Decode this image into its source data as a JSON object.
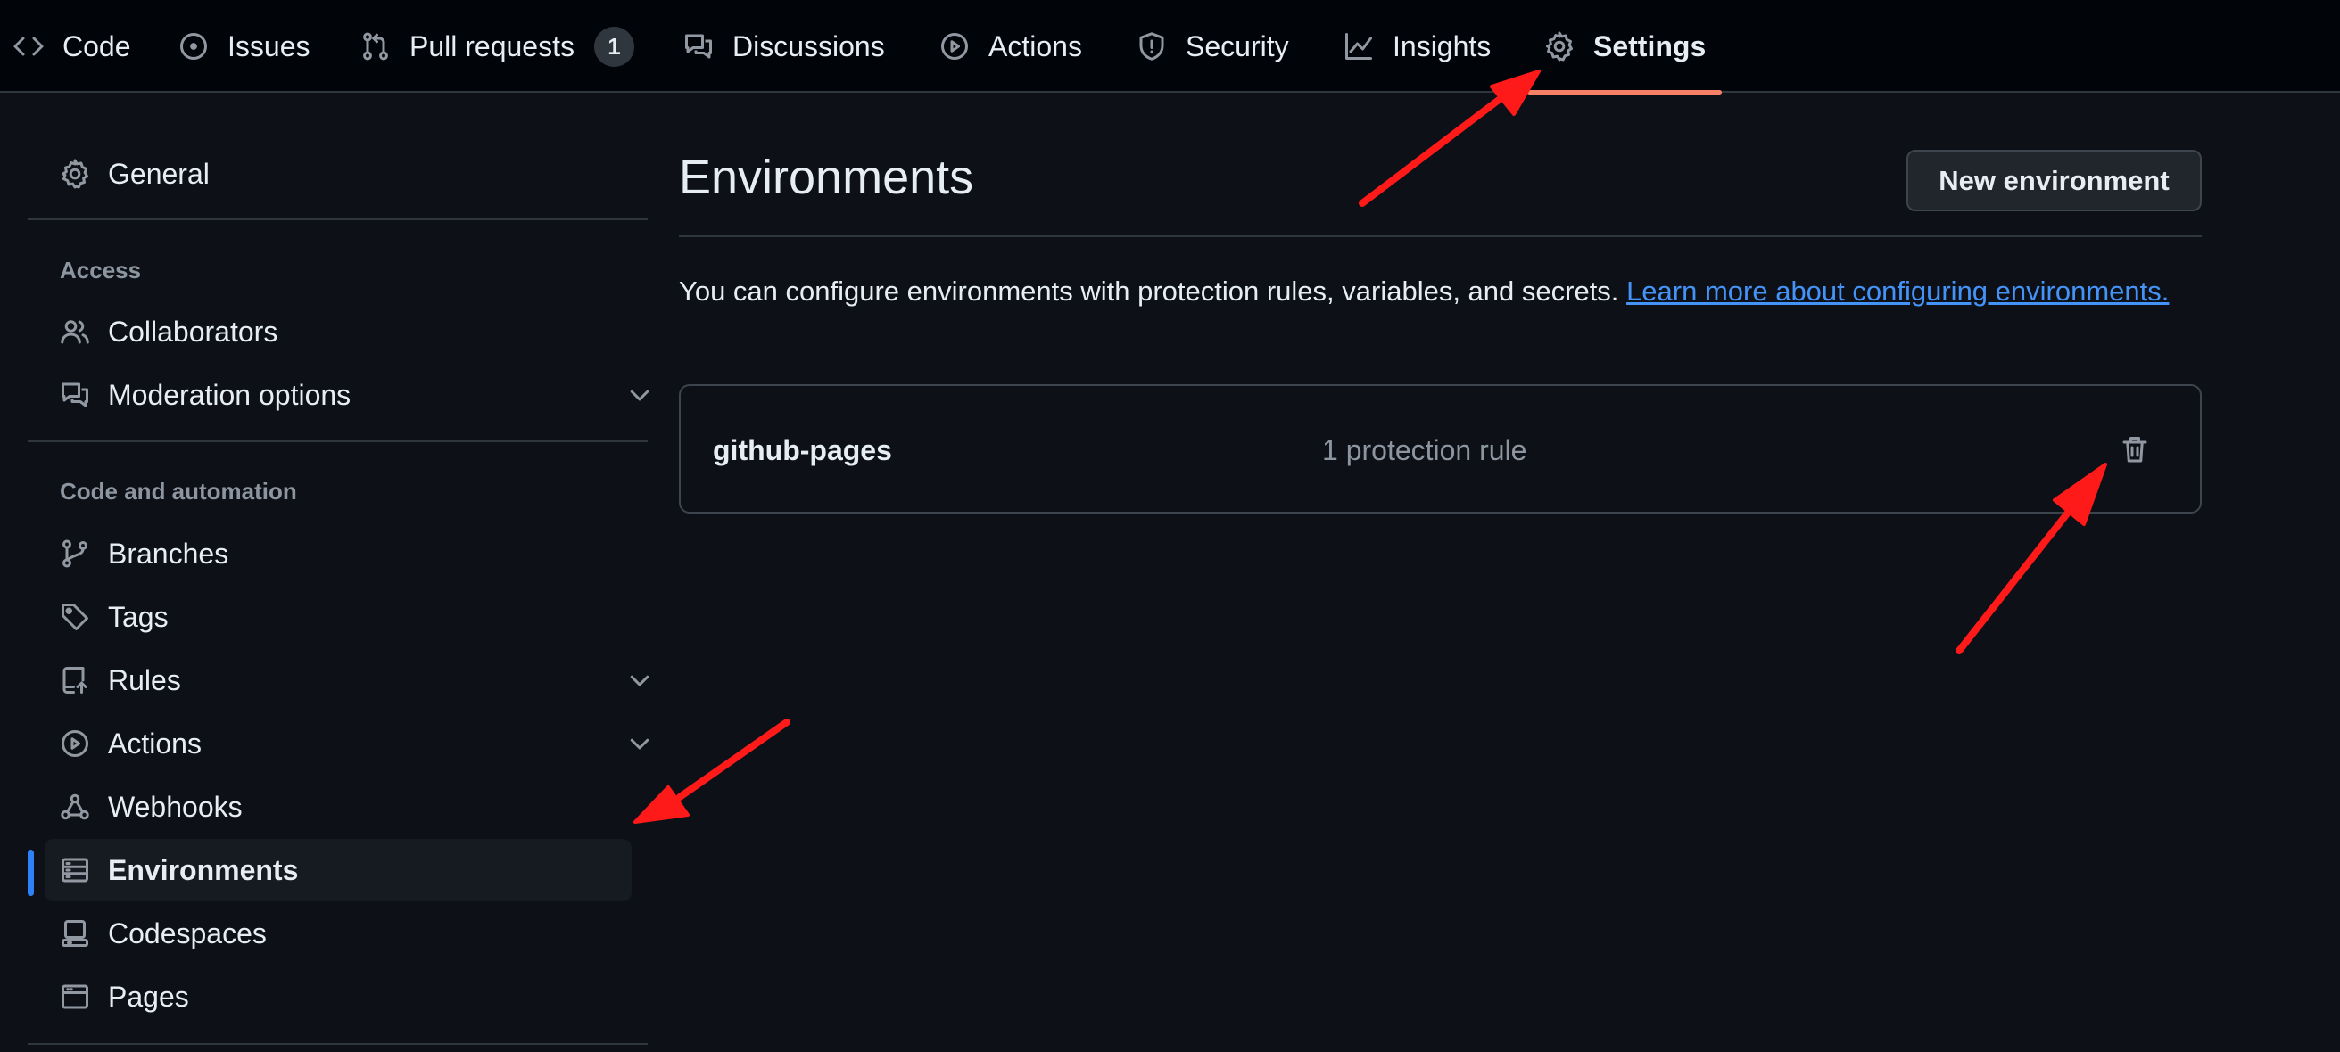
{
  "topnav": {
    "tabs": [
      {
        "label": "Code",
        "icon": "code-icon"
      },
      {
        "label": "Issues",
        "icon": "issue-icon"
      },
      {
        "label": "Pull requests",
        "icon": "pull-request-icon",
        "count": "1"
      },
      {
        "label": "Discussions",
        "icon": "discussions-icon"
      },
      {
        "label": "Actions",
        "icon": "play-icon"
      },
      {
        "label": "Security",
        "icon": "shield-icon"
      },
      {
        "label": "Insights",
        "icon": "graph-icon"
      },
      {
        "label": "Settings",
        "icon": "gear-icon",
        "active": true
      }
    ]
  },
  "sidebar": {
    "general": {
      "label": "General",
      "icon": "gear-icon"
    },
    "access_heading": "Access",
    "access_items": [
      {
        "label": "Collaborators",
        "icon": "people-icon"
      },
      {
        "label": "Moderation options",
        "icon": "comment-discussion-icon",
        "expandable": true
      }
    ],
    "automation_heading": "Code and automation",
    "automation_items": [
      {
        "label": "Branches",
        "icon": "branch-icon"
      },
      {
        "label": "Tags",
        "icon": "tag-icon"
      },
      {
        "label": "Rules",
        "icon": "repo-push-icon",
        "expandable": true
      },
      {
        "label": "Actions",
        "icon": "play-icon",
        "expandable": true
      },
      {
        "label": "Webhooks",
        "icon": "webhook-icon"
      },
      {
        "label": "Environments",
        "icon": "server-icon",
        "selected": true
      },
      {
        "label": "Codespaces",
        "icon": "codespaces-icon"
      },
      {
        "label": "Pages",
        "icon": "browser-icon"
      }
    ]
  },
  "main": {
    "title": "Environments",
    "new_button": "New environment",
    "description": "You can configure environments with protection rules, variables, and secrets.",
    "learn_more_link": "Learn more about configuring environments.",
    "environments": [
      {
        "name": "github-pages",
        "rules": "1 protection rule",
        "action_icon": "trash-icon"
      }
    ]
  },
  "colors": {
    "accent_active_tab": "#f78166",
    "selected_indicator": "#2f81f7",
    "link": "#4493f8",
    "annotation_arrow": "#ff1a1a"
  }
}
